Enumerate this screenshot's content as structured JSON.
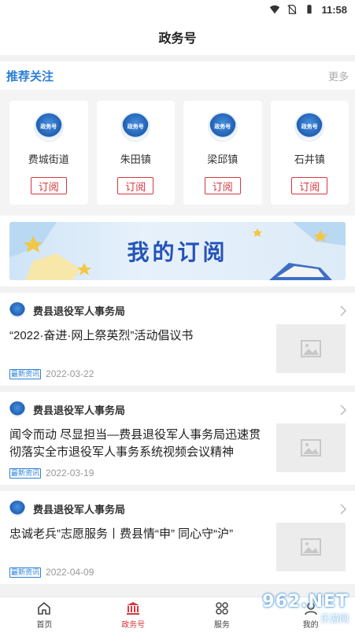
{
  "status_bar": {
    "time": "11:58"
  },
  "header": {
    "title": "政务号"
  },
  "recommend": {
    "title": "推荐关注",
    "more_label": "更多",
    "logo_text": "政务号",
    "cards": [
      {
        "name": "费城街道",
        "button": "订阅"
      },
      {
        "name": "朱田镇",
        "button": "订阅"
      },
      {
        "name": "梁邱镇",
        "button": "订阅"
      },
      {
        "name": "石井镇",
        "button": "订阅"
      }
    ]
  },
  "banner": {
    "text": "我的订阅"
  },
  "news": [
    {
      "source": "费县退役军人事务局",
      "title": "“2022·奋进·网上祭英烈”活动倡议书",
      "tag": "最新资讯",
      "date": "2022-03-22"
    },
    {
      "source": "费县退役军人事务局",
      "title": "闻令而动 尽显担当—费县退役军人事务局迅速贯彻落实全市退役军人事务系统视频会议精神",
      "tag": "最新资讯",
      "date": "2022-03-19"
    },
    {
      "source": "费县退役军人事务局",
      "title": "忠诚老兵”志愿服务丨费县情“申” 同心守“沪”",
      "tag": "最新资讯",
      "date": "2022-04-09"
    }
  ],
  "tabs": [
    {
      "label": "首页",
      "icon": "home-icon"
    },
    {
      "label": "政务号",
      "icon": "government-building-icon"
    },
    {
      "label": "服务",
      "icon": "grid-icon"
    },
    {
      "label": "我的",
      "icon": "user-icon"
    }
  ],
  "watermark": {
    "top": "962.NET",
    "bottom": "乐游网"
  },
  "colors": {
    "accent_red": "#d9363e",
    "accent_blue": "#2b7fd6"
  }
}
